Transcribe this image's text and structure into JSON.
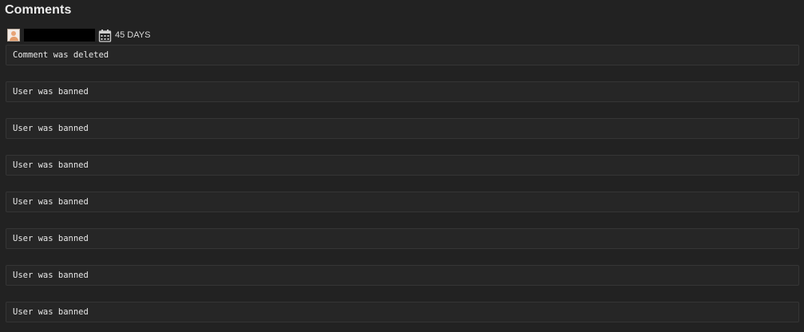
{
  "section": {
    "title": "Comments"
  },
  "comment_meta": {
    "avatar_icon": "user-avatar-icon",
    "username": "",
    "age_icon": "calendar-icon",
    "age": "45 DAYS"
  },
  "comments": [
    {
      "text": "Comment was deleted"
    },
    {
      "text": "User was banned"
    },
    {
      "text": "User was banned"
    },
    {
      "text": "User was banned"
    },
    {
      "text": "User was banned"
    },
    {
      "text": "User was banned"
    },
    {
      "text": "User was banned"
    },
    {
      "text": "User was banned"
    }
  ],
  "colors": {
    "background": "#222222",
    "box_background": "#262626",
    "box_border": "#353535",
    "text": "#e8e8e8"
  }
}
